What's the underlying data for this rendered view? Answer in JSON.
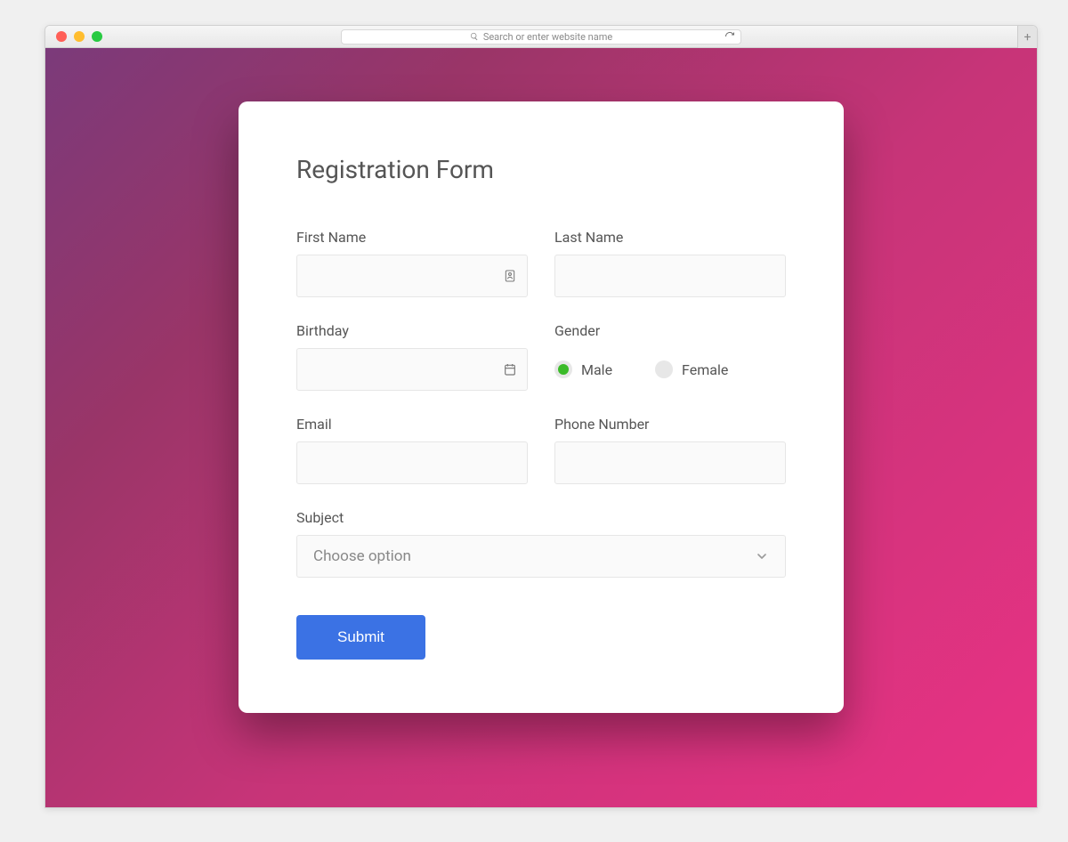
{
  "browser": {
    "url_placeholder": "Search or enter website name"
  },
  "page": {
    "title": "Registration Form",
    "fields": {
      "first_name": {
        "label": "First Name",
        "value": ""
      },
      "last_name": {
        "label": "Last Name",
        "value": ""
      },
      "birthday": {
        "label": "Birthday",
        "value": ""
      },
      "gender": {
        "label": "Gender",
        "options": [
          {
            "label": "Male",
            "checked": true
          },
          {
            "label": "Female",
            "checked": false
          }
        ]
      },
      "email": {
        "label": "Email",
        "value": ""
      },
      "phone": {
        "label": "Phone Number",
        "value": ""
      },
      "subject": {
        "label": "Subject",
        "selected": "Choose option"
      }
    },
    "submit": "Submit"
  },
  "colors": {
    "accent": "#3b72e4",
    "radio_selected": "#3bbb29"
  }
}
